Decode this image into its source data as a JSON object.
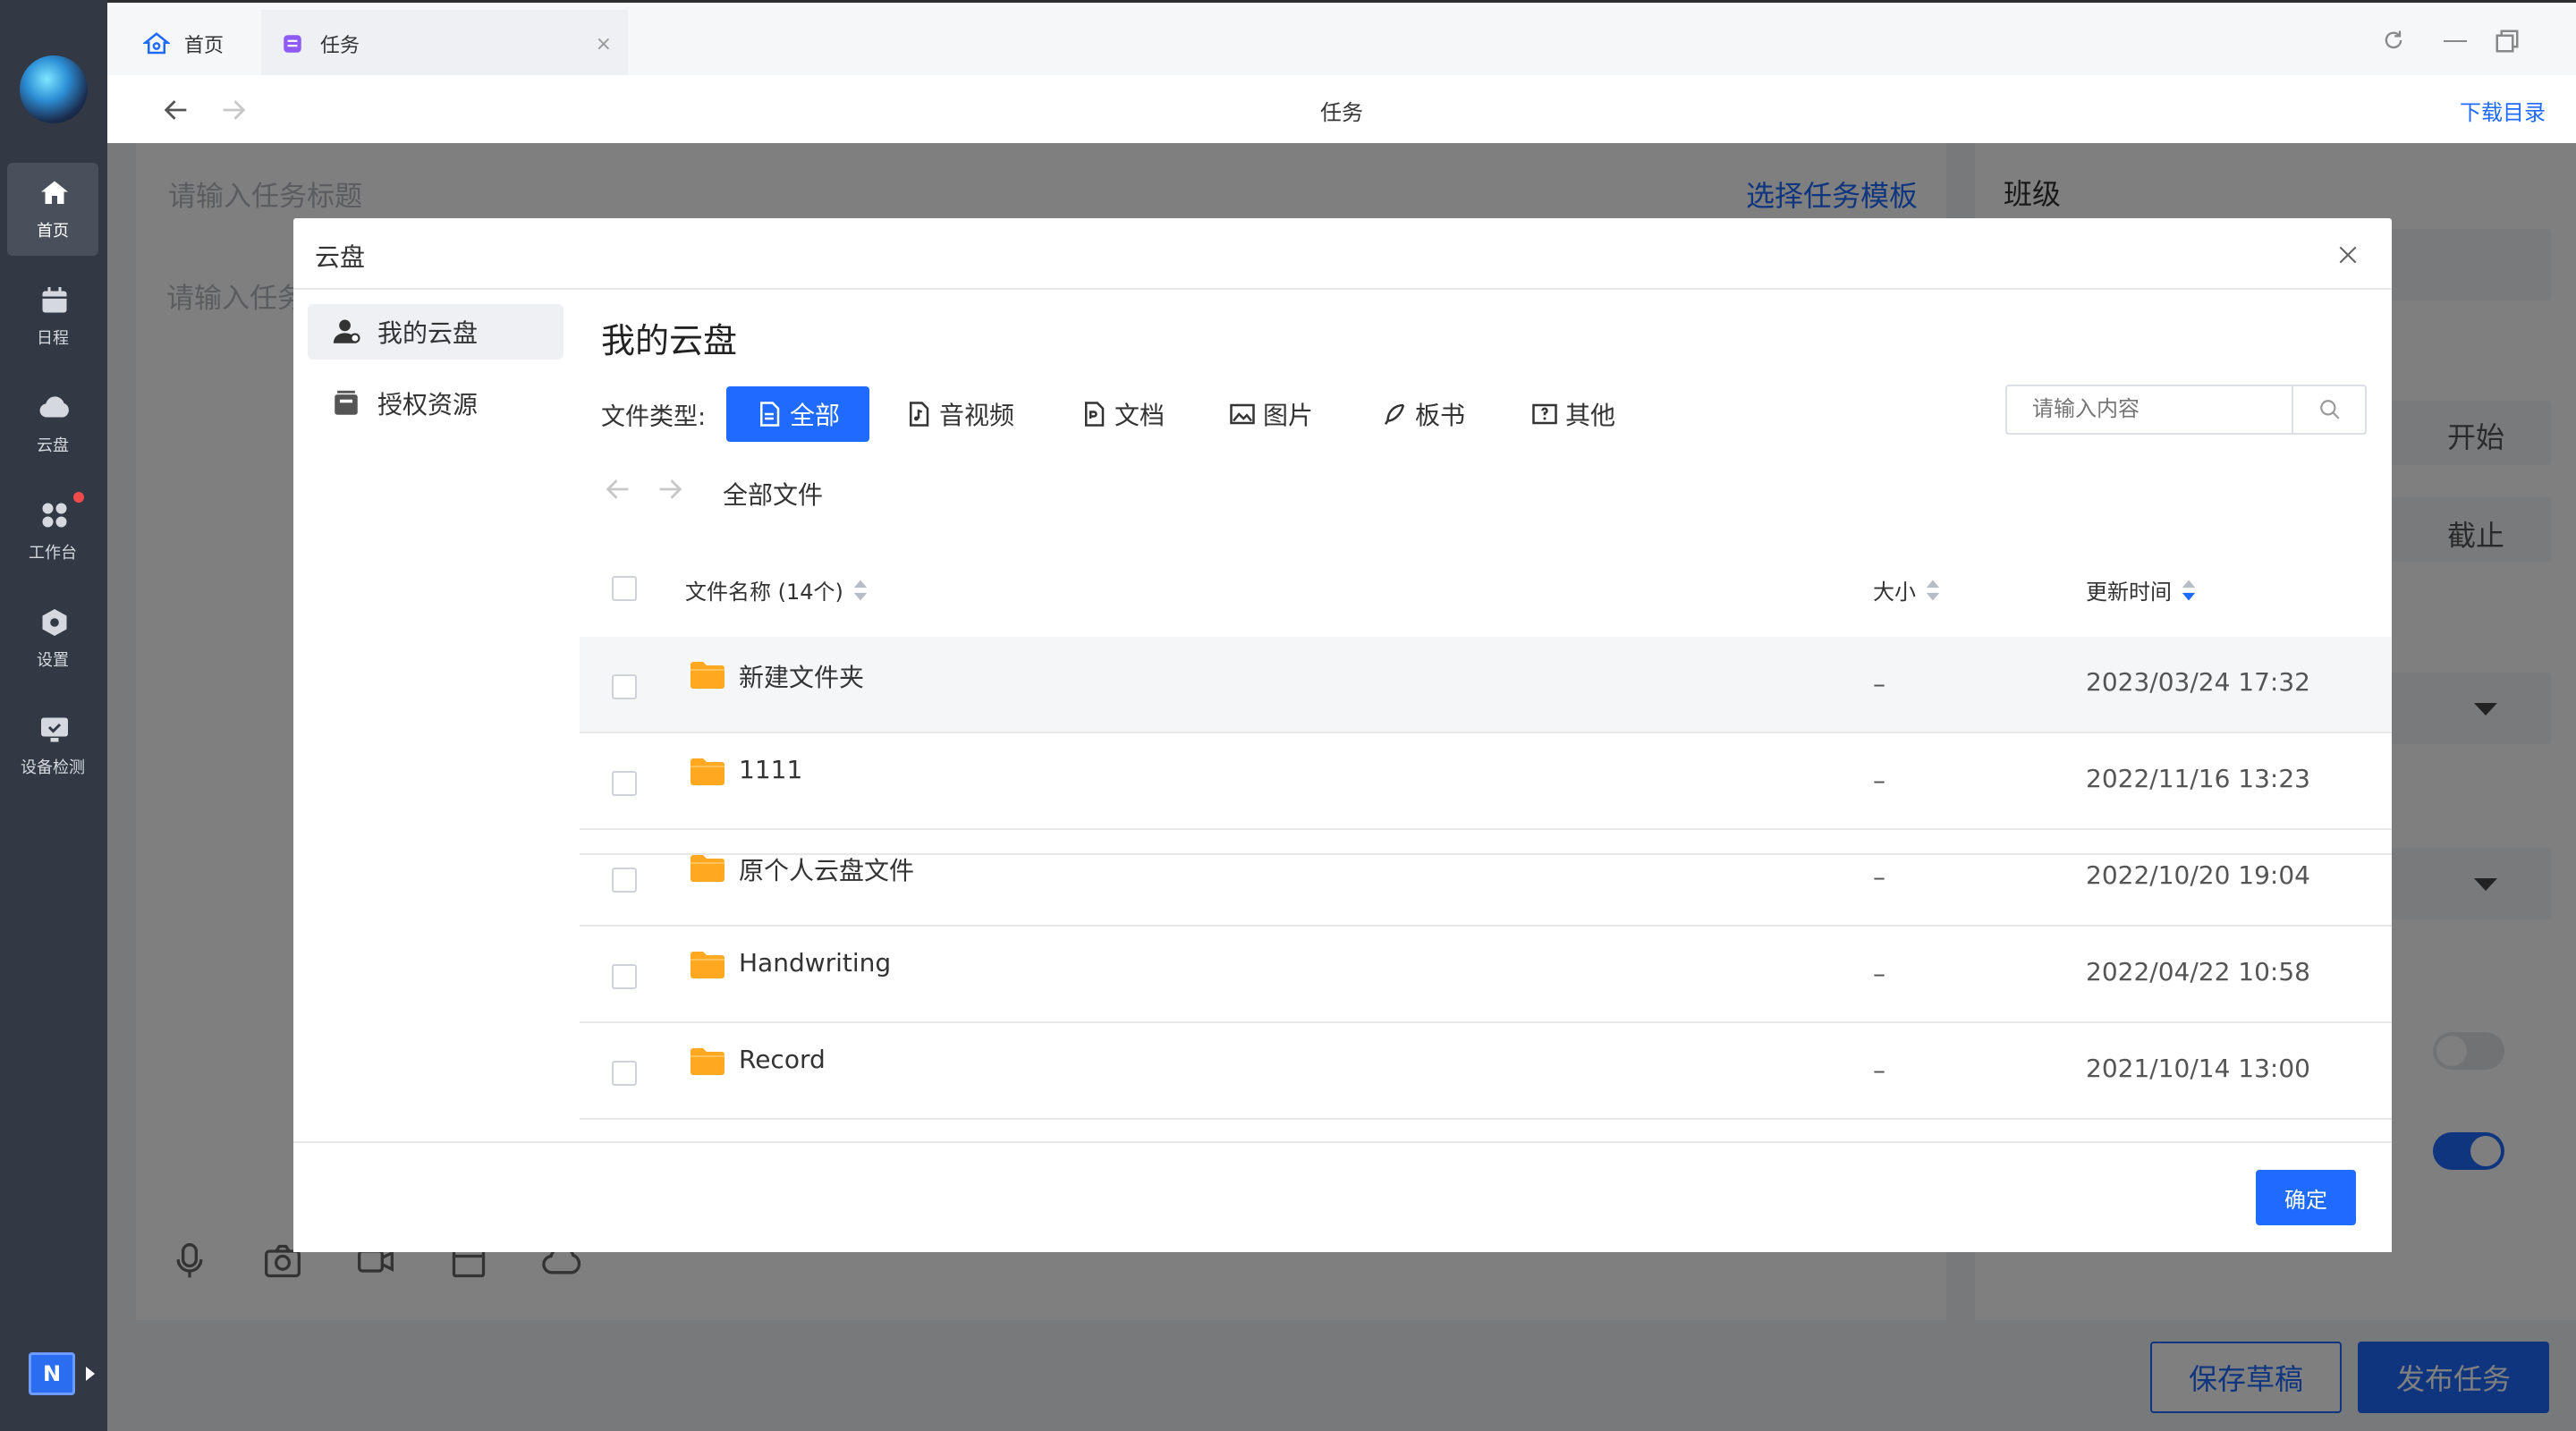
{
  "tabs": [
    {
      "label": "首页"
    },
    {
      "label": "任务"
    }
  ],
  "navbar": {
    "title": "任务",
    "download_link": "下载目录"
  },
  "rail": {
    "items": [
      {
        "label": "首页"
      },
      {
        "label": "日程"
      },
      {
        "label": "云盘"
      },
      {
        "label": "工作台"
      },
      {
        "label": "设置"
      },
      {
        "label": "设备检测"
      }
    ],
    "badge": "N"
  },
  "background_form": {
    "title_placeholder": "请输入任务标题",
    "template_link": "选择任务模板",
    "content_placeholder": "请输入任务",
    "class_label": "班级",
    "start_label": "开始",
    "deadline_label": "截止",
    "save_draft": "保存草稿",
    "publish": "发布任务"
  },
  "modal": {
    "title": "云盘",
    "side_items": [
      {
        "label": "我的云盘"
      },
      {
        "label": "授权资源"
      }
    ],
    "heading": "我的云盘",
    "filter_label": "文件类型:",
    "filters": [
      {
        "label": "全部"
      },
      {
        "label": "音视频"
      },
      {
        "label": "文档"
      },
      {
        "label": "图片"
      },
      {
        "label": "板书"
      },
      {
        "label": "其他"
      }
    ],
    "search_placeholder": "请输入内容",
    "breadcrumb": "全部文件",
    "columns": {
      "name": "文件名称 (14个)",
      "size": "大小",
      "time": "更新时间"
    },
    "rows": [
      {
        "name": "新建文件夹",
        "size": "–",
        "time": "2023/03/24 17:32"
      },
      {
        "name": "1111",
        "size": "–",
        "time": "2022/11/16 13:23"
      },
      {
        "name": "原个人云盘文件",
        "size": "–",
        "time": "2022/10/20 19:04"
      },
      {
        "name": "Handwriting",
        "size": "–",
        "time": "2022/04/22 10:58"
      },
      {
        "name": "Record",
        "size": "–",
        "time": "2021/10/14 13:00"
      }
    ],
    "confirm": "确定"
  },
  "colors": {
    "accent": "#1f6bff",
    "rail": "#323844",
    "folder": "#ffa820"
  }
}
